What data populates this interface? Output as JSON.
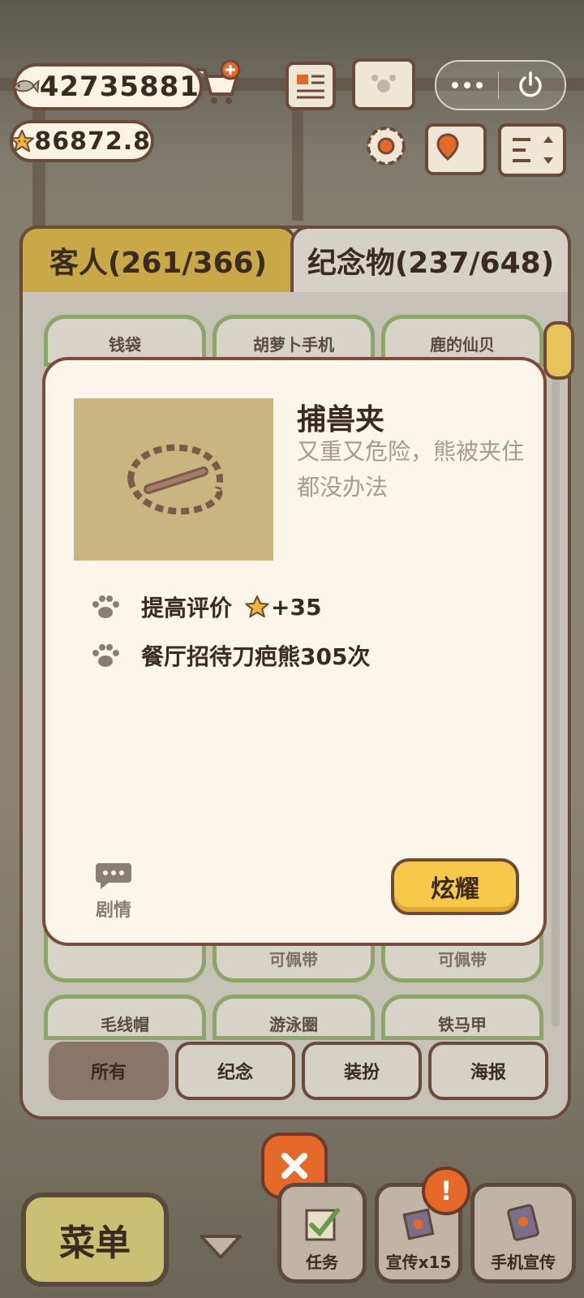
{
  "hud": {
    "fish_count": "42735881",
    "star_count": "86872.8"
  },
  "tabs": {
    "guests": "客人(261/366)",
    "souvenirs": "纪念物(237/648)"
  },
  "grid": {
    "top_row": [
      "钱袋",
      "胡萝卜手机",
      "鹿的仙贝"
    ],
    "middle_row_tags": [
      "",
      "可佩带",
      "可佩带"
    ],
    "bottom_row": [
      "毛线帽",
      "游泳圈",
      "铁马甲"
    ]
  },
  "filters": [
    "所有",
    "纪念",
    "装扮",
    "海报"
  ],
  "modal": {
    "item_name": "捕兽夹",
    "item_desc": "又重又危险，熊被夹住都没办法",
    "stat_1_label": "提高评价",
    "stat_1_value": "+35",
    "stat_2": "餐厅招待刀疤熊305次",
    "story_label": "剧情",
    "show_button": "炫耀"
  },
  "bottom_bar": {
    "menu": "菜单",
    "tasks": "任务",
    "promo": "宣传x15",
    "phone_promo": "手机宣传",
    "alert_mark": "!"
  },
  "colors": {
    "accent_yellow": "#f7c94a",
    "border_brown": "#6b4a3a",
    "card_green_border": "#8ea56a",
    "close_orange": "#e56a2a"
  }
}
